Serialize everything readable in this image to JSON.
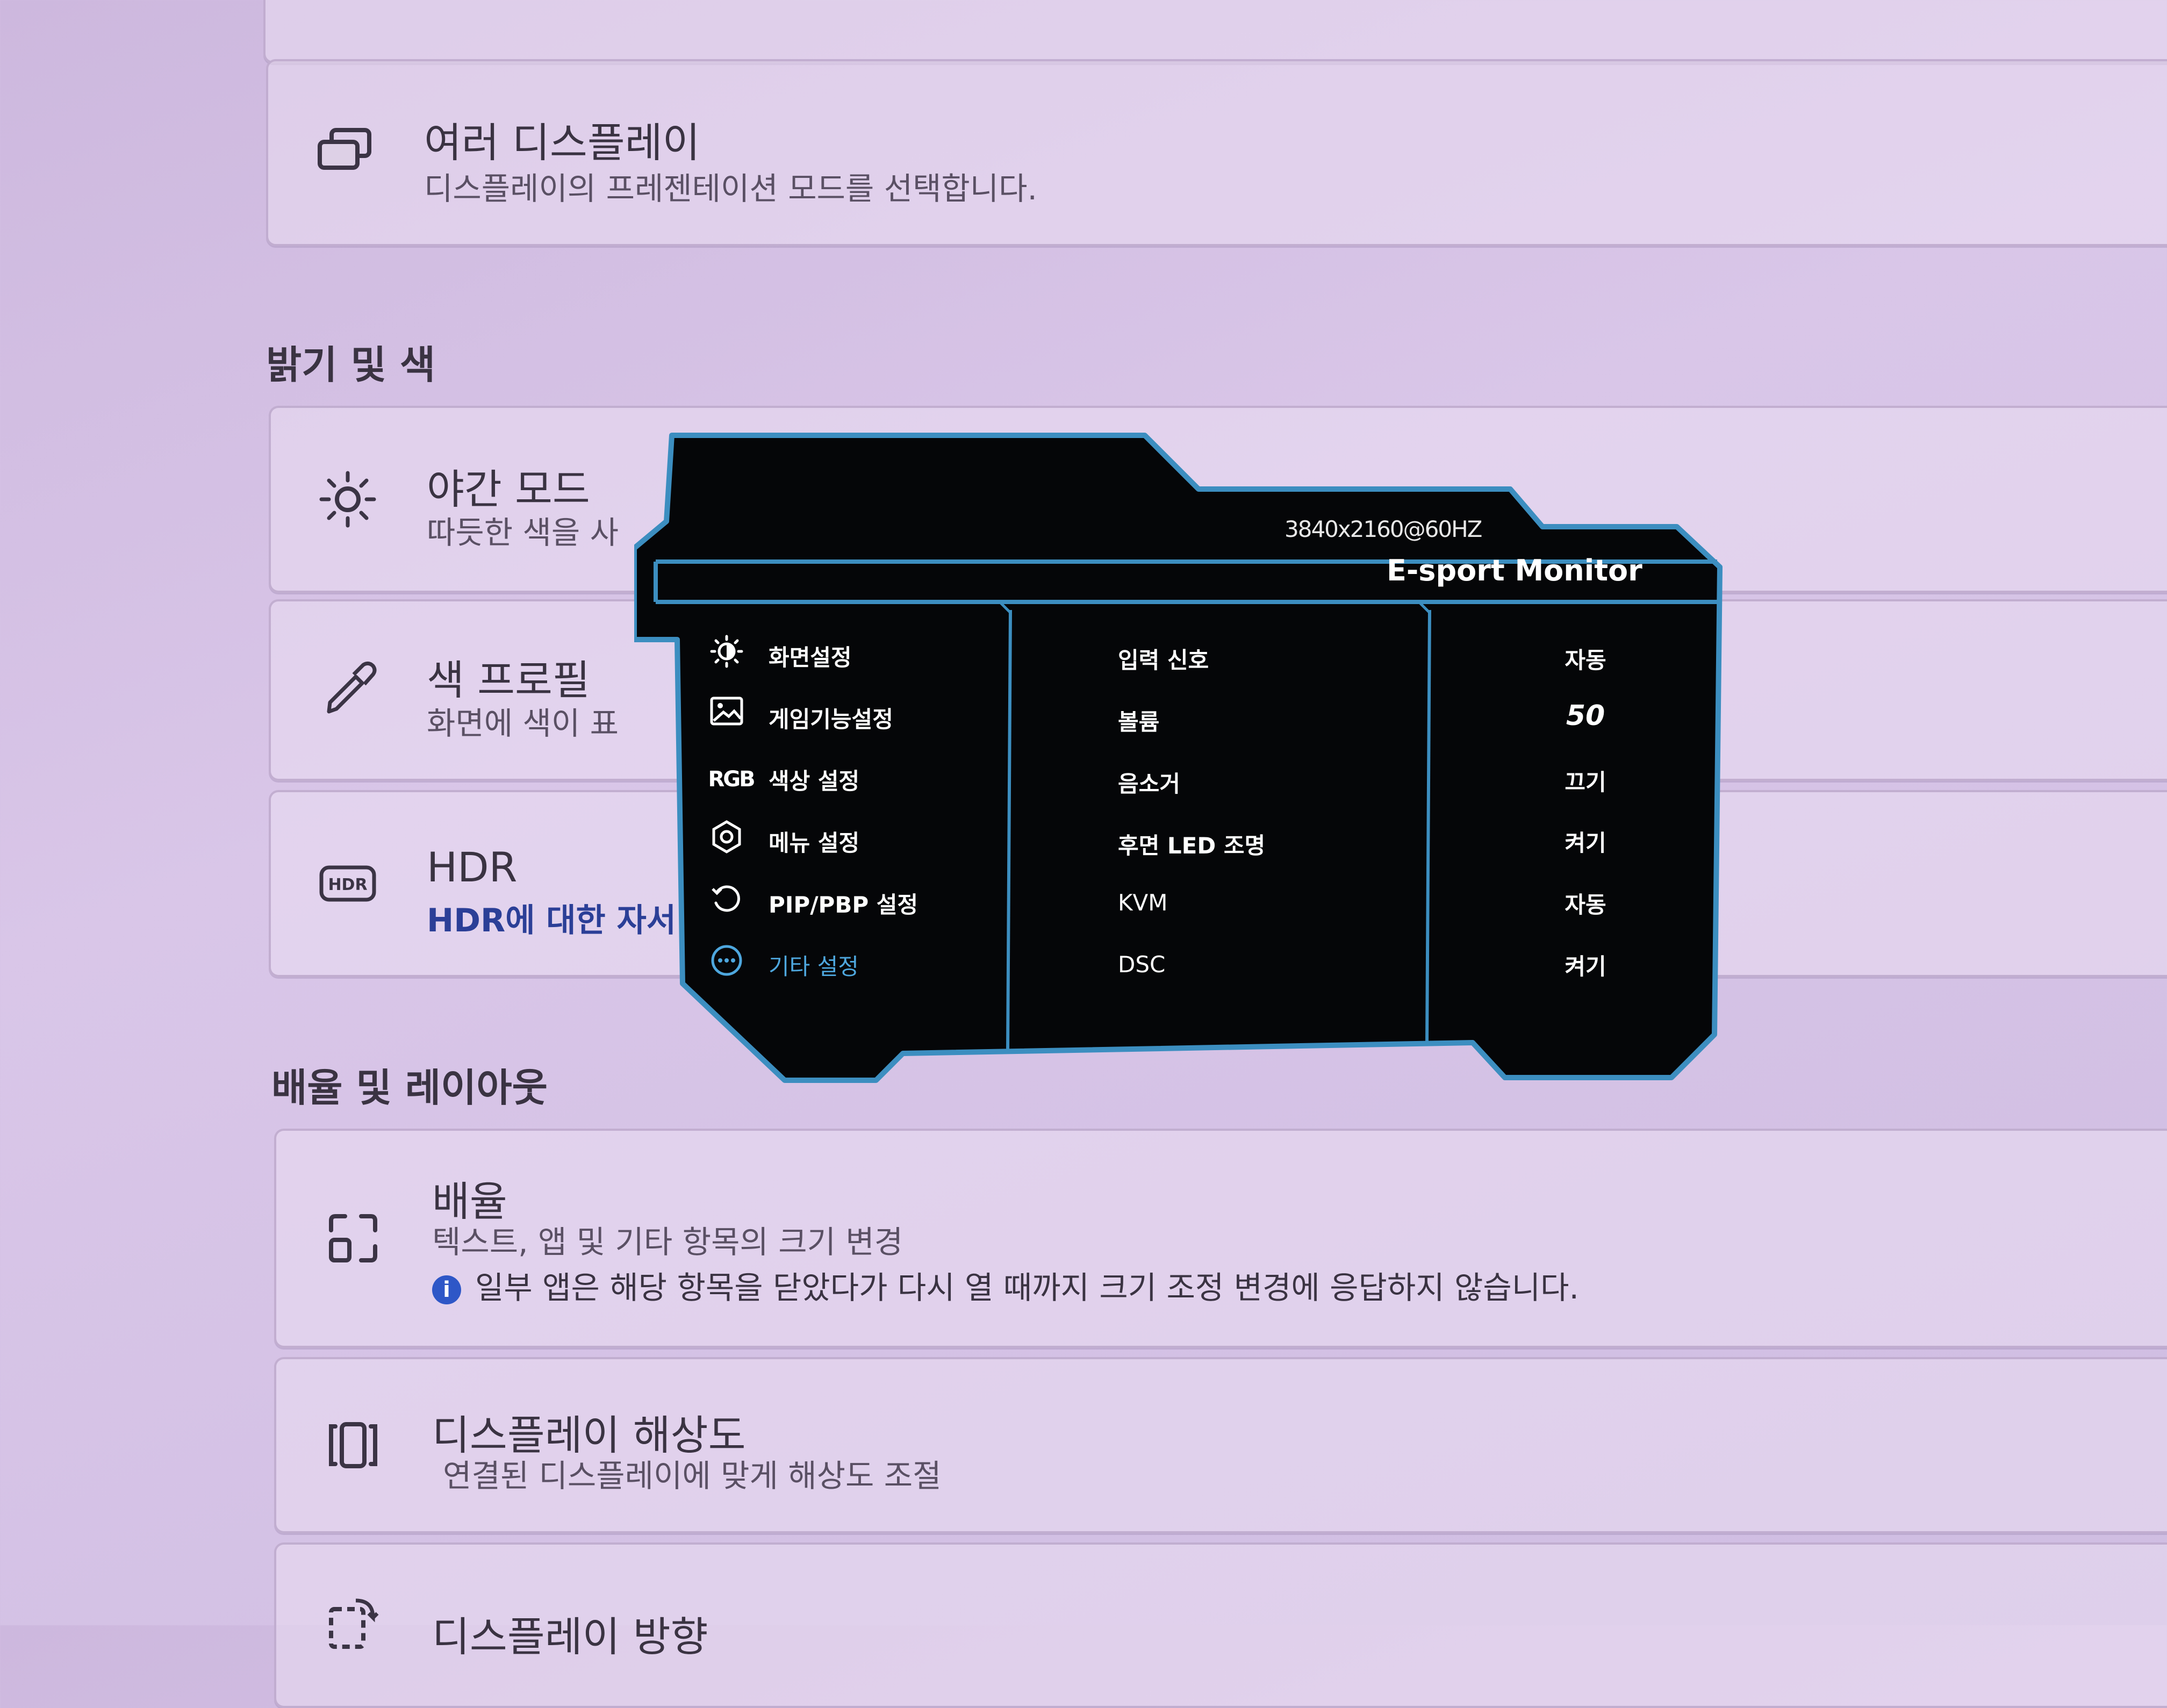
{
  "settings": {
    "multi_display": {
      "title": "여러 디스플레이",
      "subtitle": "디스플레이의 프레젠테이션 모드를 선택합니다."
    },
    "brightness_section": "밝기 및 색",
    "night_mode": {
      "title": "야간 모드",
      "subtitle": "따듯한 색을 사"
    },
    "color_profile": {
      "title": "색 프로필",
      "subtitle": "화면에 색이 표"
    },
    "hdr": {
      "title": "HDR",
      "link": "HDR에 대한 자서"
    },
    "scale_section": "배율 및 레이아웃",
    "scale": {
      "title": "배율",
      "subtitle": "텍스트, 앱 및 기타 항목의 크기 변경",
      "info_icon": "i",
      "info": "일부 앱은 해당 항목을 닫았다가 다시 열 때까지 크기 조정 변경에 응답하지 않습니다."
    },
    "resolution": {
      "title": "디스플레이 해상도",
      "subtitle": "연결된 디스플레이에 맞게 해상도 조절"
    },
    "orientation": {
      "title": "디스플레이 방향"
    }
  },
  "osd": {
    "resolution": "3840x2160@60HZ",
    "brand": "E-sport Monitor",
    "accent_color": "#4ea7de",
    "menu": [
      {
        "icon": "brightness-icon",
        "label": "화면설정"
      },
      {
        "icon": "image-icon",
        "label": "게임기능설정"
      },
      {
        "icon": "rgb-icon",
        "icon_text": "RGB",
        "label": "색상 설정"
      },
      {
        "icon": "gear-icon",
        "label": "메뉴 설정"
      },
      {
        "icon": "rotate-icon",
        "label": "PIP/PBP 설정"
      },
      {
        "icon": "more-icon",
        "label": "기타 설정",
        "active": true
      }
    ],
    "submenu": [
      {
        "label": "입력 신호",
        "value": "자동"
      },
      {
        "label": "볼륨",
        "value": "50"
      },
      {
        "label": "음소거",
        "value": "끄기"
      },
      {
        "label": "후면 LED 조명",
        "value": "켜기"
      },
      {
        "label": "KVM",
        "value": "자동"
      },
      {
        "label": "DSC",
        "value": "켜기"
      }
    ]
  }
}
